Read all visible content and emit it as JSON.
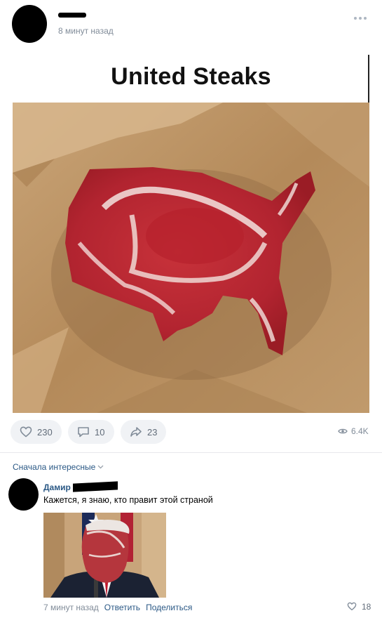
{
  "post": {
    "time": "8 минут назад",
    "more_icon": "more-dots-icon"
  },
  "meme": {
    "title": "United Steaks"
  },
  "actions": {
    "likes": "230",
    "comments": "10",
    "shares": "23",
    "views": "6.4K"
  },
  "comments_section": {
    "sort_label": "Сначала интересные"
  },
  "comment": {
    "author_first_name": "Дамир",
    "text": "Кажется, я знаю, кто правит этой страной",
    "time": "7 минут назад",
    "reply_label": "Ответить",
    "share_label": "Поделиться",
    "likes": "18"
  },
  "colors": {
    "link": "#2a5885",
    "secondary": "#818c99",
    "button_bg": "#f0f2f5"
  }
}
